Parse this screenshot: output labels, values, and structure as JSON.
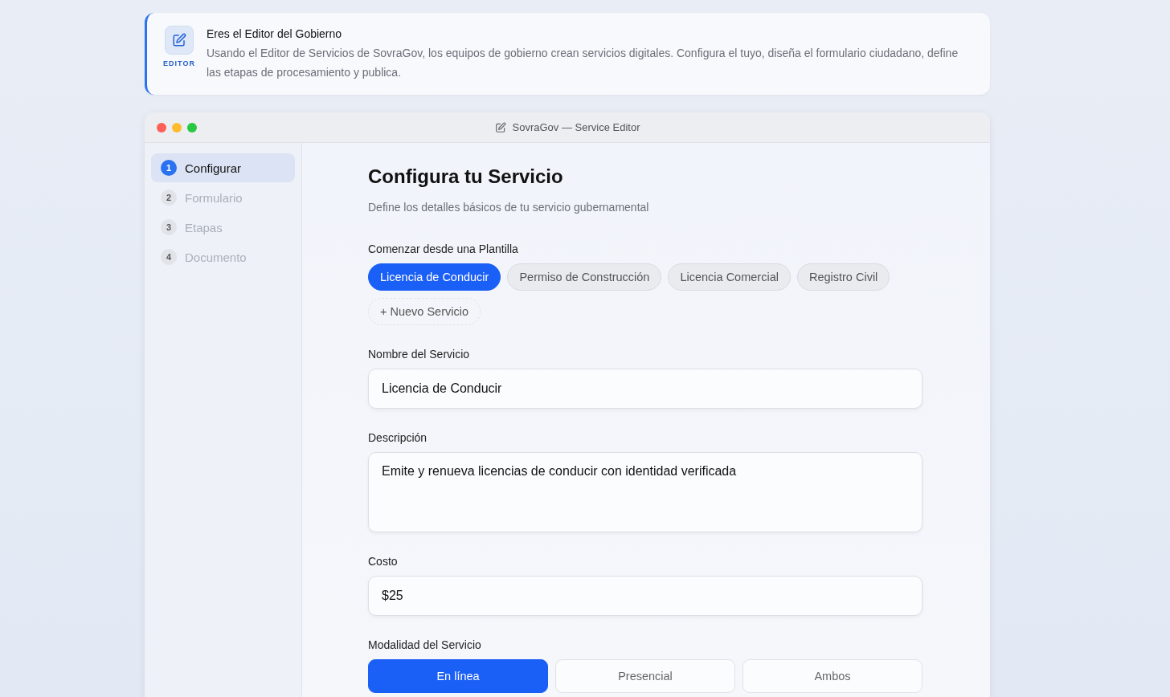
{
  "banner": {
    "badge": "EDITOR",
    "title": "Eres el Editor del Gobierno",
    "text": "Usando el Editor de Servicios de SovraGov, los equipos de gobierno crean servicios digitales. Configura el tuyo, diseña el formulario ciudadano, define las etapas de procesamiento y publica."
  },
  "window": {
    "title": "SovraGov — Service Editor"
  },
  "sidebar": {
    "steps": [
      {
        "number": "1",
        "label": "Configurar",
        "selected": true
      },
      {
        "number": "2",
        "label": "Formulario",
        "selected": false
      },
      {
        "number": "3",
        "label": "Etapas",
        "selected": false
      },
      {
        "number": "4",
        "label": "Documento",
        "selected": false
      }
    ]
  },
  "main": {
    "heading": "Configura tu Servicio",
    "subtitle": "Define los detalles básicos de tu servicio gubernamental",
    "templates": {
      "label": "Comenzar desde una Plantilla",
      "items": [
        {
          "label": "Licencia de Conducir",
          "selected": true
        },
        {
          "label": "Permiso de Construcción",
          "selected": false
        },
        {
          "label": "Licencia Comercial",
          "selected": false
        },
        {
          "label": "Registro Civil",
          "selected": false
        }
      ],
      "new_button": "+ Nuevo Servicio"
    },
    "fields": [
      {
        "kind": "input",
        "label": "Nombre del Servicio",
        "value": "Licencia de Conducir"
      },
      {
        "kind": "textarea",
        "label": "Descripción",
        "value": "Emite y renueva licencias de conducir con identidad verificada"
      },
      {
        "kind": "input",
        "label": "Costo",
        "value": "$25"
      }
    ],
    "modality": {
      "label": "Modalidad del Servicio",
      "options": [
        {
          "label": "En línea",
          "selected": true
        },
        {
          "label": "Presencial",
          "selected": false
        },
        {
          "label": "Ambos",
          "selected": false
        }
      ]
    }
  }
}
